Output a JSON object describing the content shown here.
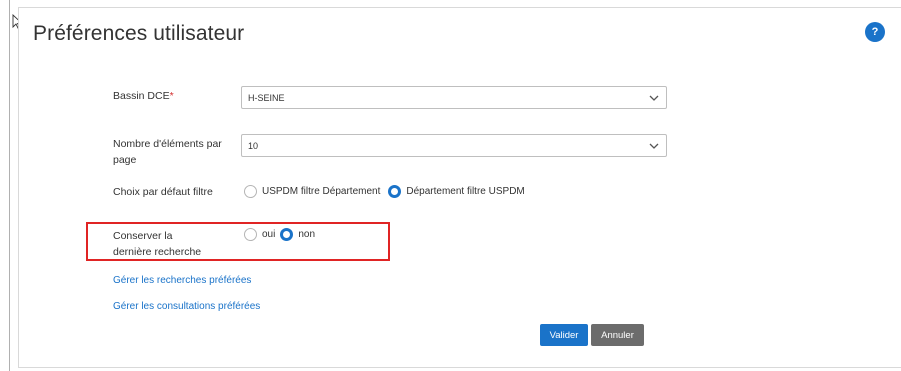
{
  "page": {
    "title": "Préférences utilisateur",
    "help_label": "?"
  },
  "form": {
    "bassin": {
      "label": "Bassin DCE",
      "required_mark": "*",
      "value": "H-SEINE"
    },
    "nb_elements": {
      "label": "Nombre d'éléments par page",
      "value": "10"
    },
    "choix_filtre": {
      "label": "Choix par défaut filtre",
      "options": [
        {
          "label": "USPDM filtre Département",
          "checked": false
        },
        {
          "label": "Département filtre USPDM",
          "checked": true
        }
      ]
    },
    "conserver": {
      "label": "Conserver la dernière recherche",
      "options": [
        {
          "label": "oui",
          "checked": false
        },
        {
          "label": "non",
          "checked": true
        }
      ]
    }
  },
  "links": {
    "recherches": "Gérer les recherches préférées",
    "consultations": "Gérer les consultations préférées"
  },
  "actions": {
    "valider": "Valider",
    "annuler": "Annuler"
  },
  "colors": {
    "accent": "#1a73c9",
    "highlight": "#e02424",
    "secondary_button": "#6c6c6c"
  }
}
